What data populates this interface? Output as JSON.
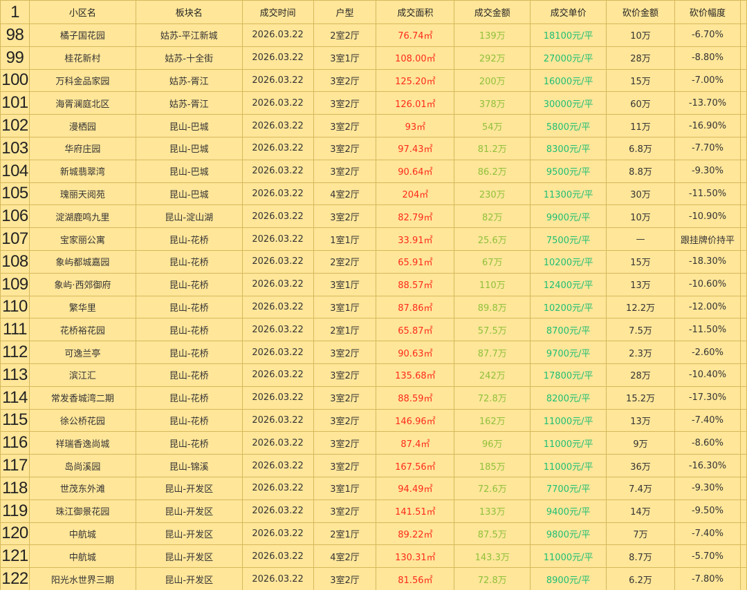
{
  "header": {
    "row_number": "1",
    "columns": [
      "小区名",
      "板块名",
      "成交时间",
      "户型",
      "成交面积",
      "成交金额",
      "成交单价",
      "砍价金额",
      "砍价幅度"
    ]
  },
  "colors": {
    "background": "#FFE699",
    "gridline": "#D6B85A",
    "area_text": "#FF2A1A",
    "amount_text": "#8FC03A",
    "price_text": "#1DBF73"
  },
  "rows": [
    {
      "num": "98",
      "cells": [
        "橘子国花园",
        "姑苏-平江新城",
        "2026.03.22",
        "2室2厅",
        "76.74㎡",
        "139万",
        "18100元/平",
        "10万",
        "-6.70%"
      ]
    },
    {
      "num": "99",
      "cells": [
        "桂花新村",
        "姑苏-十全街",
        "2026.03.22",
        "3室1厅",
        "108.00㎡",
        "292万",
        "27000元/平",
        "28万",
        "-8.80%"
      ]
    },
    {
      "num": "100",
      "cells": [
        "万科金品家园",
        "姑苏-胥江",
        "2026.03.22",
        "3室2厅",
        "125.20㎡",
        "200万",
        "16000元/平",
        "15万",
        "-7.00%"
      ]
    },
    {
      "num": "101",
      "cells": [
        "海胥澜庭北区",
        "姑苏-胥江",
        "2026.03.22",
        "3室2厅",
        "126.01㎡",
        "378万",
        "30000元/平",
        "60万",
        "-13.70%"
      ]
    },
    {
      "num": "102",
      "cells": [
        "漫栖园",
        "昆山-巴城",
        "2026.03.22",
        "3室2厅",
        "93㎡",
        "54万",
        "5800元/平",
        "11万",
        "-16.90%"
      ]
    },
    {
      "num": "103",
      "cells": [
        "华府庄园",
        "昆山-巴城",
        "2026.03.22",
        "3室2厅",
        "97.43㎡",
        "81.2万",
        "8300元/平",
        "6.8万",
        "-7.70%"
      ]
    },
    {
      "num": "104",
      "cells": [
        "新城翡翠湾",
        "昆山-巴城",
        "2026.03.22",
        "3室2厅",
        "90.64㎡",
        "86.2万",
        "9500元/平",
        "8.8万",
        "-9.30%"
      ]
    },
    {
      "num": "105",
      "cells": [
        "瑰丽天阅苑",
        "昆山-巴城",
        "2026.03.22",
        "4室2厅",
        "204㎡",
        "230万",
        "11300元/平",
        "30万",
        "-11.50%"
      ]
    },
    {
      "num": "106",
      "cells": [
        "淀湖鹿鸣九里",
        "昆山-淀山湖",
        "2026.03.22",
        "3室2厅",
        "82.79㎡",
        "82万",
        "9900元/平",
        "10万",
        "-10.90%"
      ]
    },
    {
      "num": "107",
      "cells": [
        "宝家丽公寓",
        "昆山-花桥",
        "2026.03.22",
        "1室1厅",
        "33.91㎡",
        "25.6万",
        "7500元/平",
        "—",
        "跟挂牌价持平"
      ]
    },
    {
      "num": "108",
      "cells": [
        "象屿都城嘉园",
        "昆山-花桥",
        "2026.03.22",
        "2室2厅",
        "65.91㎡",
        "67万",
        "10200元/平",
        "15万",
        "-18.30%"
      ]
    },
    {
      "num": "109",
      "cells": [
        "象屿·西郊御府",
        "昆山-花桥",
        "2026.03.22",
        "3室1厅",
        "88.57㎡",
        "110万",
        "12400元/平",
        "13万",
        "-10.60%"
      ]
    },
    {
      "num": "110",
      "cells": [
        "繁华里",
        "昆山-花桥",
        "2026.03.22",
        "3室1厅",
        "87.86㎡",
        "89.8万",
        "10200元/平",
        "12.2万",
        "-12.00%"
      ]
    },
    {
      "num": "111",
      "cells": [
        "花桥裕花园",
        "昆山-花桥",
        "2026.03.22",
        "2室1厅",
        "65.87㎡",
        "57.5万",
        "8700元/平",
        "7.5万",
        "-11.50%"
      ]
    },
    {
      "num": "112",
      "cells": [
        "可逸兰亭",
        "昆山-花桥",
        "2026.03.22",
        "3室2厅",
        "90.63㎡",
        "87.7万",
        "9700元/平",
        "2.3万",
        "-2.60%"
      ]
    },
    {
      "num": "113",
      "cells": [
        "滨江汇",
        "昆山-花桥",
        "2026.03.22",
        "3室2厅",
        "135.68㎡",
        "242万",
        "17800元/平",
        "28万",
        "-10.40%"
      ]
    },
    {
      "num": "114",
      "cells": [
        "常发香城湾二期",
        "昆山-花桥",
        "2026.03.22",
        "3室2厅",
        "88.59㎡",
        "72.8万",
        "8200元/平",
        "15.2万",
        "-17.30%"
      ]
    },
    {
      "num": "115",
      "cells": [
        "徐公桥花园",
        "昆山-花桥",
        "2026.03.22",
        "3室2厅",
        "146.96㎡",
        "162万",
        "11000元/平",
        "13万",
        "-7.40%"
      ]
    },
    {
      "num": "116",
      "cells": [
        "祥瑞香逸尚城",
        "昆山-花桥",
        "2026.03.22",
        "3室2厅",
        "87.4㎡",
        "96万",
        "11000元/平",
        "9万",
        "-8.60%"
      ]
    },
    {
      "num": "117",
      "cells": [
        "岛尚溪园",
        "昆山-锦溪",
        "2026.03.22",
        "3室2厅",
        "167.56㎡",
        "185万",
        "11000元/平",
        "36万",
        "-16.30%"
      ]
    },
    {
      "num": "118",
      "cells": [
        "世茂东外滩",
        "昆山-开发区",
        "2026.03.22",
        "3室1厅",
        "94.49㎡",
        "72.6万",
        "7700元/平",
        "7.4万",
        "-9.30%"
      ]
    },
    {
      "num": "119",
      "cells": [
        "珠江御景花园",
        "昆山-开发区",
        "2026.03.22",
        "3室2厅",
        "141.51㎡",
        "133万",
        "9400元/平",
        "14万",
        "-9.50%"
      ]
    },
    {
      "num": "120",
      "cells": [
        "中航城",
        "昆山-开发区",
        "2026.03.22",
        "2室1厅",
        "89.22㎡",
        "87.5万",
        "9800元/平",
        "7万",
        "-7.40%"
      ]
    },
    {
      "num": "121",
      "cells": [
        "中航城",
        "昆山-开发区",
        "2026.03.22",
        "4室2厅",
        "130.31㎡",
        "143.3万",
        "11000元/平",
        "8.7万",
        "-5.70%"
      ]
    },
    {
      "num": "122",
      "cells": [
        "阳光水世界三期",
        "昆山-开发区",
        "2026.03.22",
        "3室2厅",
        "81.56㎡",
        "72.8万",
        "8900元/平",
        "6.2万",
        "-7.80%"
      ]
    }
  ]
}
